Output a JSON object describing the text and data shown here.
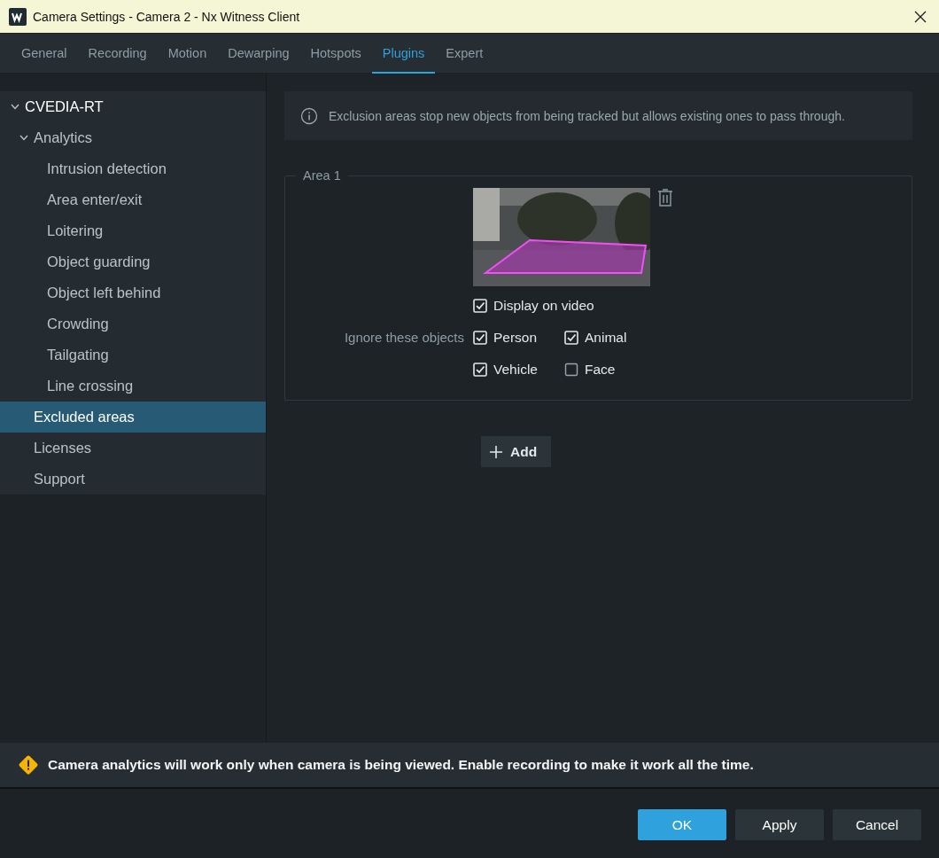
{
  "window": {
    "title": "Camera Settings - Camera 2 - Nx Witness Client"
  },
  "tabs": [
    {
      "label": "General",
      "selected": false
    },
    {
      "label": "Recording",
      "selected": false
    },
    {
      "label": "Motion",
      "selected": false
    },
    {
      "label": "Dewarping",
      "selected": false
    },
    {
      "label": "Hotspots",
      "selected": false
    },
    {
      "label": "Plugins",
      "selected": true
    },
    {
      "label": "Expert",
      "selected": false
    }
  ],
  "sidebar": {
    "items": [
      {
        "label": "CVEDIA-RT",
        "selected": false,
        "expanded": true,
        "children": [
          {
            "label": "Analytics",
            "selected": false,
            "expanded": true,
            "children": [
              {
                "label": "Intrusion detection",
                "selected": false
              },
              {
                "label": "Area enter/exit",
                "selected": false
              },
              {
                "label": "Loitering",
                "selected": false
              },
              {
                "label": "Object guarding",
                "selected": false
              },
              {
                "label": "Object left behind",
                "selected": false
              },
              {
                "label": "Crowding",
                "selected": false
              },
              {
                "label": "Tailgating",
                "selected": false
              },
              {
                "label": "Line crossing",
                "selected": false
              }
            ]
          },
          {
            "label": "Excluded areas",
            "selected": true
          },
          {
            "label": "Licenses",
            "selected": false
          },
          {
            "label": "Support",
            "selected": false
          }
        ]
      }
    ]
  },
  "info": {
    "text": "Exclusion areas stop new objects from being tracked but allows existing ones to pass through."
  },
  "areas": [
    {
      "title": "Area 1",
      "display_on_video": {
        "label": "Display on video",
        "checked": true
      },
      "ignore_label": "Ignore these objects",
      "objects": [
        {
          "label": "Person",
          "checked": true
        },
        {
          "label": "Animal",
          "checked": true
        },
        {
          "label": "Vehicle",
          "checked": true
        },
        {
          "label": "Face",
          "checked": false
        }
      ]
    }
  ],
  "add_button": {
    "label": "Add"
  },
  "warning": {
    "text": "Camera analytics will work only when camera is being viewed. Enable recording to make it work all the time."
  },
  "buttons": [
    {
      "label": "OK",
      "kind": "primary"
    },
    {
      "label": "Apply",
      "kind": "secondary"
    },
    {
      "label": "Cancel",
      "kind": "secondary"
    }
  ]
}
